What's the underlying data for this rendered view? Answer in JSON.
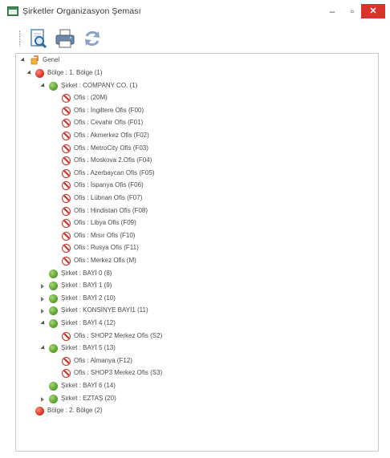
{
  "window": {
    "title": "Şirketler Organizasyon Şeması",
    "min_glyph": "–",
    "max_glyph": "▫",
    "close_glyph": "✕",
    "close_color": "#d9342b"
  },
  "toolbar": {
    "buttons": [
      {
        "name": "preview",
        "icon": "print-preview-icon"
      },
      {
        "name": "print",
        "icon": "printer-icon"
      },
      {
        "name": "refresh",
        "icon": "refresh-icon"
      }
    ]
  },
  "tree": {
    "root": "Genel",
    "nodes": [
      {
        "level": 1,
        "icon": "red",
        "expander": "expanded",
        "label": "Bölge : 1. Bölge  (1)"
      },
      {
        "level": 2,
        "icon": "green",
        "expander": "expanded",
        "label": "Şirket : COMPANY CO.  (1)"
      },
      {
        "level": 3,
        "icon": "office",
        "expander": "none",
        "label": "Ofis :  (20M)"
      },
      {
        "level": 3,
        "icon": "office",
        "expander": "none",
        "label": "Ofis : İngiltere Ofis  (F00)"
      },
      {
        "level": 3,
        "icon": "office",
        "expander": "none",
        "label": "Ofis : Cevahir Ofis  (F01)"
      },
      {
        "level": 3,
        "icon": "office",
        "expander": "none",
        "label": "Ofis : Akmerkez Ofis  (F02)"
      },
      {
        "level": 3,
        "icon": "office",
        "expander": "none",
        "label": "Ofis : MetroCity Ofis  (F03)"
      },
      {
        "level": 3,
        "icon": "office",
        "expander": "none",
        "label": "Ofis : Moskova 2.Ofis  (F04)"
      },
      {
        "level": 3,
        "icon": "office",
        "expander": "none",
        "label": "Ofis : Azerbaycan Ofis  (F05)"
      },
      {
        "level": 3,
        "icon": "office",
        "expander": "none",
        "label": "Ofis : İspanya Ofis  (F06)"
      },
      {
        "level": 3,
        "icon": "office",
        "expander": "none",
        "label": "Ofis : Lübnan Ofis  (F07)"
      },
      {
        "level": 3,
        "icon": "office",
        "expander": "none",
        "label": "Ofis : Hindistan Ofis  (F08)"
      },
      {
        "level": 3,
        "icon": "office",
        "expander": "none",
        "label": "Ofis : Libya Ofis  (F09)"
      },
      {
        "level": 3,
        "icon": "office",
        "expander": "none",
        "label": "Ofis : Mısır Ofis  (F10)"
      },
      {
        "level": 3,
        "icon": "office",
        "expander": "none",
        "label": "Ofis : Rusya Ofis  (F11)"
      },
      {
        "level": 3,
        "icon": "office",
        "expander": "none",
        "label": "Ofis : Merkez Ofis  (M)"
      },
      {
        "level": 2,
        "icon": "green",
        "expander": "none",
        "label": "Şirket : BAYİ 0  (8)"
      },
      {
        "level": 2,
        "icon": "green",
        "expander": "collapsed",
        "label": "Şirket : BAYİ 1  (9)"
      },
      {
        "level": 2,
        "icon": "green",
        "expander": "collapsed",
        "label": "Şirket : BAYİ 2  (10)"
      },
      {
        "level": 2,
        "icon": "green",
        "expander": "collapsed",
        "label": "Şirket : KONSİNYE BAYİ1  (11)"
      },
      {
        "level": 2,
        "icon": "green",
        "expander": "expanded",
        "label": "Şirket : BAYİ 4  (12)"
      },
      {
        "level": 3,
        "icon": "office",
        "expander": "none",
        "label": "Ofis : SHOP2 Merkez Ofis  (S2)"
      },
      {
        "level": 2,
        "icon": "green",
        "expander": "expanded",
        "label": "Şirket : BAYİ 5  (13)"
      },
      {
        "level": 3,
        "icon": "office",
        "expander": "none",
        "label": "Ofis : Almanya  (F12)"
      },
      {
        "level": 3,
        "icon": "office",
        "expander": "none",
        "label": "Ofis : SHOP3 Merkez Ofis  (S3)"
      },
      {
        "level": 2,
        "icon": "green",
        "expander": "none",
        "label": "Şirket : BAYİ 6  (14)"
      },
      {
        "level": 2,
        "icon": "green",
        "expander": "collapsed",
        "label": "Şirket : EZTAŞ  (20)"
      },
      {
        "level": 1,
        "icon": "red",
        "expander": "none",
        "label": "Bölge : 2. Bölge  (2)"
      }
    ]
  }
}
